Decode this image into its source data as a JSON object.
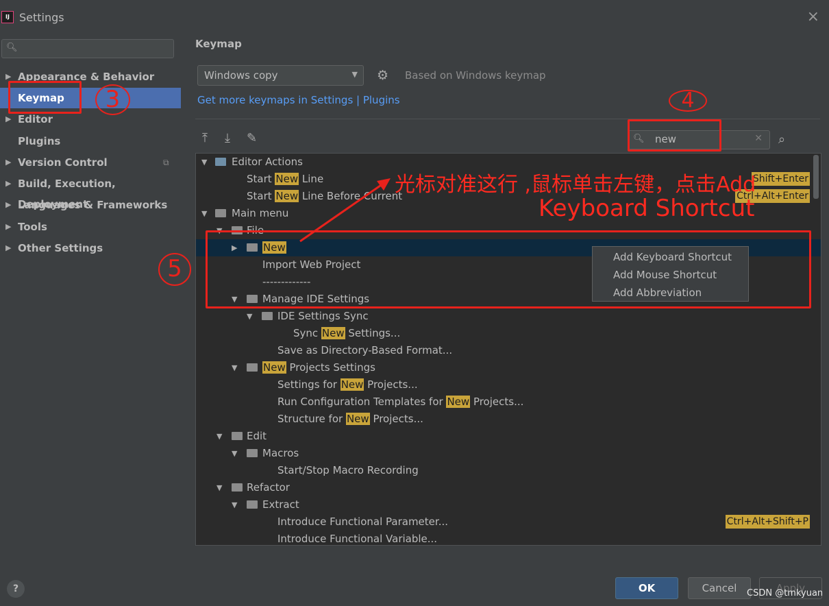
{
  "window": {
    "title": "Settings",
    "logo": "IJ",
    "close_icon": "×"
  },
  "sidebar": {
    "search_placeholder": "",
    "items": [
      {
        "label": "Appearance & Behavior",
        "expandable": true
      },
      {
        "label": "Keymap",
        "expandable": false,
        "selected": true
      },
      {
        "label": "Editor",
        "expandable": true
      },
      {
        "label": "Plugins",
        "expandable": false
      },
      {
        "label": "Version Control",
        "expandable": true
      },
      {
        "label": "Build, Execution, Deployment",
        "expandable": true
      },
      {
        "label": "Languages & Frameworks",
        "expandable": true
      },
      {
        "label": "Tools",
        "expandable": true
      },
      {
        "label": "Other Settings",
        "expandable": true
      }
    ]
  },
  "keymap": {
    "title": "Keymap",
    "selected_keymap": "Windows copy",
    "based_on": "Based on Windows keymap",
    "more_link": "Get more keymaps in Settings | Plugins",
    "filter_value": "new",
    "highlight_term": "New"
  },
  "tree": [
    {
      "pre": "Editor Actions",
      "hl": "",
      "post": ""
    },
    {
      "pre": "Start ",
      "hl": "New",
      "post": " Line",
      "shortcut": "Shift+Enter"
    },
    {
      "pre": "Start ",
      "hl": "New",
      "post": " Line Before Current",
      "shortcut": "Ctrl+Alt+Enter"
    },
    {
      "pre": "Main menu",
      "hl": "",
      "post": ""
    },
    {
      "pre": "File",
      "hl": "",
      "post": ""
    },
    {
      "pre": "",
      "hl": "New",
      "post": ""
    },
    {
      "pre": "Import Web Project",
      "hl": "",
      "post": ""
    },
    {
      "pre": "-------------",
      "hl": "",
      "post": ""
    },
    {
      "pre": "Manage IDE Settings",
      "hl": "",
      "post": ""
    },
    {
      "pre": "IDE Settings Sync",
      "hl": "",
      "post": ""
    },
    {
      "pre": "Sync ",
      "hl": "New",
      "post": " Settings..."
    },
    {
      "pre": "Save as Directory-Based Format...",
      "hl": "",
      "post": ""
    },
    {
      "pre": "",
      "hl": "New",
      "post": " Projects Settings"
    },
    {
      "pre": "Settings for ",
      "hl": "New",
      "post": " Projects..."
    },
    {
      "pre": "Run Configuration Templates for ",
      "hl": "New",
      "post": " Projects..."
    },
    {
      "pre": "Structure for ",
      "hl": "New",
      "post": " Projects..."
    },
    {
      "pre": "Edit",
      "hl": "",
      "post": ""
    },
    {
      "pre": "Macros",
      "hl": "",
      "post": ""
    },
    {
      "pre": "Start/Stop Macro Recording",
      "hl": "",
      "post": ""
    },
    {
      "pre": "Refactor",
      "hl": "",
      "post": ""
    },
    {
      "pre": "Extract",
      "hl": "",
      "post": ""
    },
    {
      "pre": "Introduce Functional Parameter...",
      "hl": "",
      "post": "",
      "shortcut": "Ctrl+Alt+Shift+P"
    },
    {
      "pre": "Introduce Functional Variable...",
      "hl": "",
      "post": ""
    }
  ],
  "popup_menu": [
    "Add Keyboard Shortcut",
    "Add Mouse Shortcut",
    "Add Abbreviation"
  ],
  "footer": {
    "help": "?",
    "ok": "OK",
    "cancel": "Cancel",
    "apply": "Apply"
  },
  "annotations": {
    "step3": "3",
    "step4": "4",
    "step5": "5",
    "instruction_line1": "光标对准这行 ,鼠标单击左键，点击Add",
    "instruction_line2": "Keyboard Shortcut"
  },
  "watermark": "CSDN @tmkyuan",
  "colors": {
    "accent": "#4b6eaf",
    "link": "#589df6",
    "highlight": "#c9a43a",
    "annotation": "#e8221c"
  }
}
